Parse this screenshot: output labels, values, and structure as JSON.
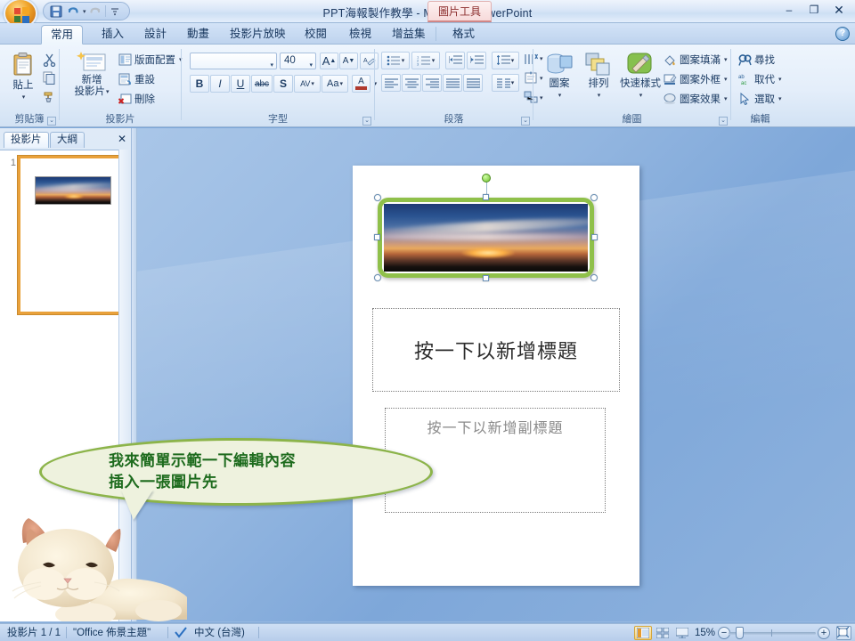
{
  "window": {
    "title": "PPT海報製作教學 - Microsoft PowerPoint",
    "contextual_tab": "圖片工具",
    "minimize": "–",
    "maximize": "❐",
    "close": "✕",
    "help": "?"
  },
  "quick_access": {
    "save": "save-icon",
    "undo": "undo-icon",
    "redo": "redo-icon",
    "customize": "customize-icon"
  },
  "tabs": [
    {
      "label": "常用",
      "active": true
    },
    {
      "label": "插入",
      "active": false
    },
    {
      "label": "設計",
      "active": false
    },
    {
      "label": "動畫",
      "active": false
    },
    {
      "label": "投影片放映",
      "active": false
    },
    {
      "label": "校閱",
      "active": false
    },
    {
      "label": "檢視",
      "active": false
    },
    {
      "label": "增益集",
      "active": false
    },
    {
      "label": "格式",
      "active": false
    }
  ],
  "ribbon": {
    "clipboard": {
      "label": "剪貼簿",
      "paste": "貼上",
      "cut": "cut-icon",
      "copy": "copy-icon",
      "format_painter": "format-painter-icon"
    },
    "slides": {
      "label": "投影片",
      "new_slide": "新增\n投影片",
      "new_slide_line1": "新增",
      "new_slide_line2": "投影片",
      "layout": "版面配置",
      "reset": "重設",
      "delete": "刪除"
    },
    "font": {
      "label": "字型",
      "font_name": "",
      "font_size": "40",
      "grow_font": "A",
      "shrink_font": "A",
      "clear_format": "clear-formatting-icon",
      "bold": "B",
      "italic": "I",
      "underline": "U",
      "strikethrough": "abc",
      "shadow": "S",
      "char_spacing": "AV",
      "change_case": "Aa",
      "font_color": "A"
    },
    "paragraph": {
      "label": "段落",
      "bullets": "bullets-icon",
      "numbering": "numbering-icon",
      "decrease_indent": "decrease-indent-icon",
      "increase_indent": "increase-indent-icon",
      "line_spacing": "line-spacing-icon",
      "text_direction": "text-direction-icon",
      "align_text": "align-text-icon",
      "convert_smartart": "smartart-icon",
      "align_left": "align-left-icon",
      "align_center": "align-center-icon",
      "align_right": "align-right-icon",
      "justify": "justify-icon",
      "distributed": "distributed-icon",
      "columns": "columns-icon"
    },
    "drawing": {
      "label": "繪圖",
      "shapes": "圖案",
      "arrange": "排列",
      "quick_styles": "快速樣式",
      "shape_fill": "圖案填滿",
      "shape_outline": "圖案外框",
      "shape_effects": "圖案效果"
    },
    "editing": {
      "label": "編輯",
      "find": "尋找",
      "replace": "取代",
      "select": "選取"
    }
  },
  "left_pane": {
    "tab_slides": "投影片",
    "tab_outline": "大綱",
    "close": "✕",
    "thumbnail_number": "1"
  },
  "slide": {
    "title_placeholder": "按一下以新增標題",
    "subtitle_placeholder": "按一下以新增副標題",
    "picture_alt": "sunset-photo"
  },
  "callout": {
    "line1": "我來簡單示範一下編輯內容",
    "line2": "插入一張圖片先",
    "text_color": "#1d6b1d",
    "fill_color": "#eef2de",
    "border_color": "#8cb44a"
  },
  "status_bar": {
    "slide_counter": "投影片 1 / 1",
    "theme": "\"Office 佈景主題\"",
    "language": "中文 (台灣)",
    "zoom_level": "15%",
    "zoom_out": "−",
    "zoom_in": "+",
    "view_normal": "normal-view-icon",
    "view_sorter": "slide-sorter-icon",
    "view_show": "slideshow-icon",
    "fit_to_window": "fit-window-icon"
  },
  "colors": {
    "accent_green": "#8cb44a",
    "selection_orange": "#e9a13b",
    "ribbon_blue": "#cddff4",
    "workspace_blue": "#7ea7d9"
  }
}
